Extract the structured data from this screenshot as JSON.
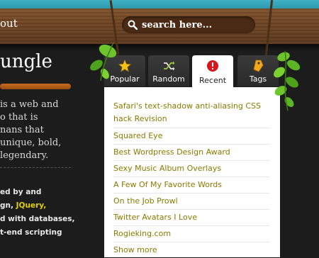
{
  "header": {
    "nav_about": "out",
    "search_placeholder": "search here..."
  },
  "sidebar": {
    "title": "ungle",
    "intro_lines": [
      "is a web and",
      "o that  is",
      "nans that",
      "unique, bold,",
      "legendary."
    ],
    "credits": [
      {
        "text": "ed by and",
        "highlight": ""
      },
      {
        "text": "gn, ",
        "highlight": "JQuery,"
      },
      {
        "text": "d with databases,",
        "highlight": ""
      },
      {
        "text": "t-end scripting",
        "highlight": ""
      }
    ]
  },
  "tabs": [
    {
      "label": "Popular",
      "icon": "star-icon",
      "active": false
    },
    {
      "label": "Random",
      "icon": "shuffle-icon",
      "active": false
    },
    {
      "label": "Recent",
      "icon": "alert-badge-icon",
      "active": true
    },
    {
      "label": "Tags",
      "icon": "tag-icon",
      "active": false
    }
  ],
  "recent_posts": [
    "Safari's text-shadow anti-aliasing CSS hack Revision",
    "Squared Eye",
    "Best Wordpress Design Award",
    "Sexy Music Album Overlays",
    "A Few Of My Favorite Words",
    "On the Job Prowl",
    "Twitter Avatars I Love",
    "Rogieking.com",
    "Show more"
  ],
  "colors": {
    "link": "#8a7a00",
    "accent": "#c96b1d",
    "highlight": "#e0d000"
  }
}
